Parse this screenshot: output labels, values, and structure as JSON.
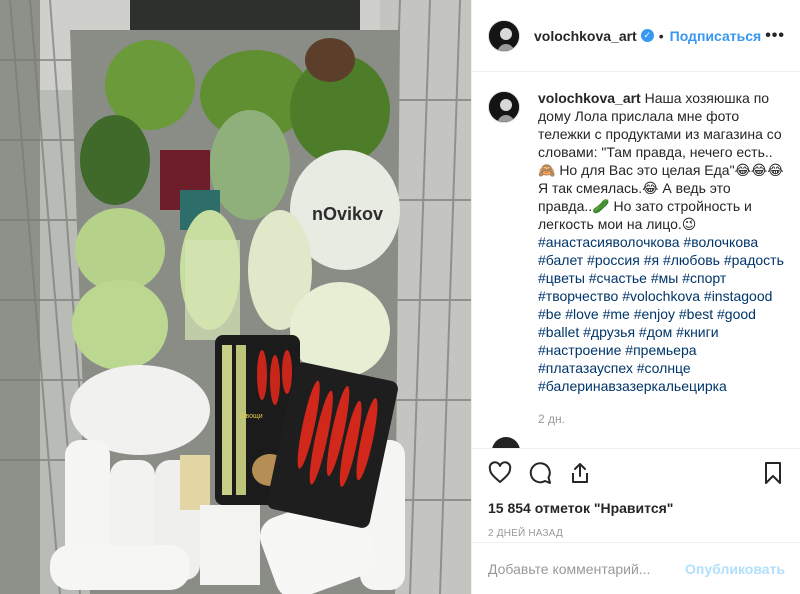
{
  "post": {
    "username": "volochkova_art",
    "dot": "•",
    "follow_label": "Подписаться",
    "more_label": "•••",
    "caption_username": "volochkova_art",
    "caption_text": "Наша хозяюшка по дому Лола прислала мне фото тележки с продуктами из магазина со словами: \"Там правда, нечего есть..🙈 Но для Вас это целая Еда\"😂😂😂 Я так смеялась.😂 А ведь это правда..🥒 Но зато стройность и легкость мои на лицо.😉",
    "hashtags": "#анастасияволочкова #волочкова #балет #россия #я #любовь #радость #цветы #счастье #мы #спорт #творчество #volochkova #instagood #be #love #me #enjoy #best #good #ballet #друзья #дом #книги #настроение #премьера #платазауспех #солнце #балеринавзазеркальецирка",
    "time_ago": "2 дн.",
    "likes": "15 854 отметок \"Нравится\"",
    "date": "2 дней назад",
    "comment_placeholder": "Добавьте комментарий...",
    "publish_label": "Опубликовать",
    "photo_labels": {
      "brand": "nOvikov",
      "pepper_brand": "Овощи"
    }
  },
  "colors": {
    "link_blue": "#3897f0",
    "hashtag": "#003569",
    "publish_disabled": "#b2dffc",
    "muted": "#999999"
  },
  "icons": [
    "heart-icon",
    "comment-icon",
    "share-icon",
    "bookmark-icon",
    "verified-badge-icon",
    "more-options-icon"
  ]
}
